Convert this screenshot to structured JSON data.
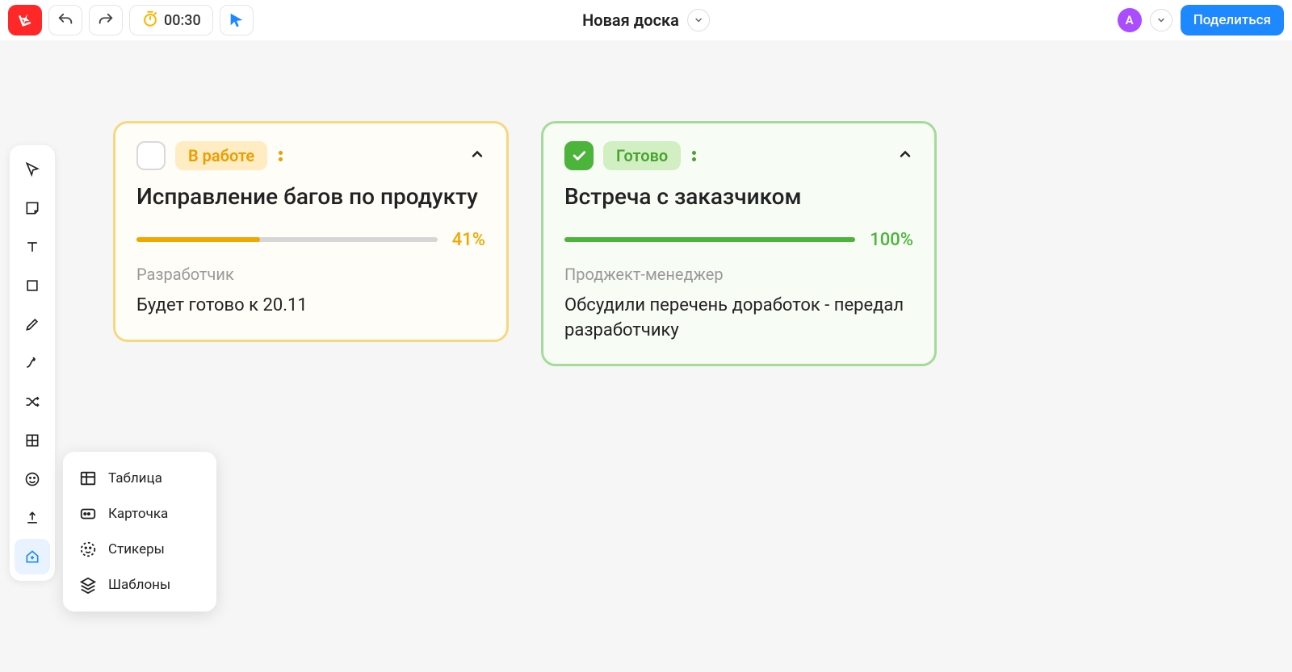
{
  "header": {
    "timer": "00:30",
    "board_title": "Новая доска",
    "avatar_letter": "А",
    "share_label": "Поделиться"
  },
  "popup": {
    "table": "Таблица",
    "card": "Карточка",
    "stickers": "Стикеры",
    "templates": "Шаблоны"
  },
  "cards": {
    "c1": {
      "status": "В работе",
      "title": "Исправление багов по продукту",
      "progress_pct": "41%",
      "progress_width": "41%",
      "role": "Разработчик",
      "note": "Будет готово к 20.11"
    },
    "c2": {
      "status": "Готово",
      "title": "Встреча с заказчиком",
      "progress_pct": "100%",
      "progress_width": "100%",
      "role": "Проджект-менеджер",
      "note": "Обсудили перечень доработок - передал разработчику"
    }
  }
}
